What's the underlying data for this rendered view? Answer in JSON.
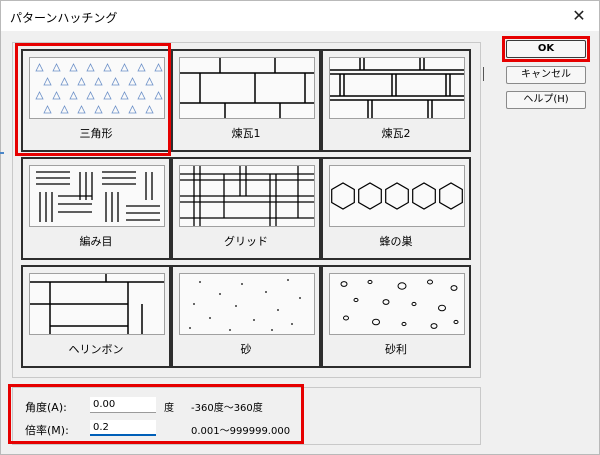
{
  "dialog": {
    "title": "パターンハッチング",
    "close_glyph": "✕"
  },
  "patterns": [
    {
      "name": "三角形",
      "selected": true
    },
    {
      "name": "煉瓦1",
      "selected": false
    },
    {
      "name": "煉瓦2",
      "selected": false
    },
    {
      "name": "編み目",
      "selected": false
    },
    {
      "name": "グリッド",
      "selected": false
    },
    {
      "name": "蜂の巣",
      "selected": false
    },
    {
      "name": "ヘリンボン",
      "selected": false
    },
    {
      "name": "砂",
      "selected": false
    },
    {
      "name": "砂利",
      "selected": false
    }
  ],
  "buttons": {
    "ok": "OK",
    "cancel": "キャンセル",
    "help": "ヘルプ(H)"
  },
  "params": {
    "angle_label": "角度(A):",
    "angle_value": "0.00",
    "angle_unit": "度",
    "angle_range": "-360度～360度",
    "scale_label": "倍率(M):",
    "scale_value": "0.2",
    "scale_range": "0.001～999999.000"
  },
  "colors": {
    "highlight": "#e60000",
    "active_input": "#005fb8",
    "triangle": "#6a8fc8"
  }
}
